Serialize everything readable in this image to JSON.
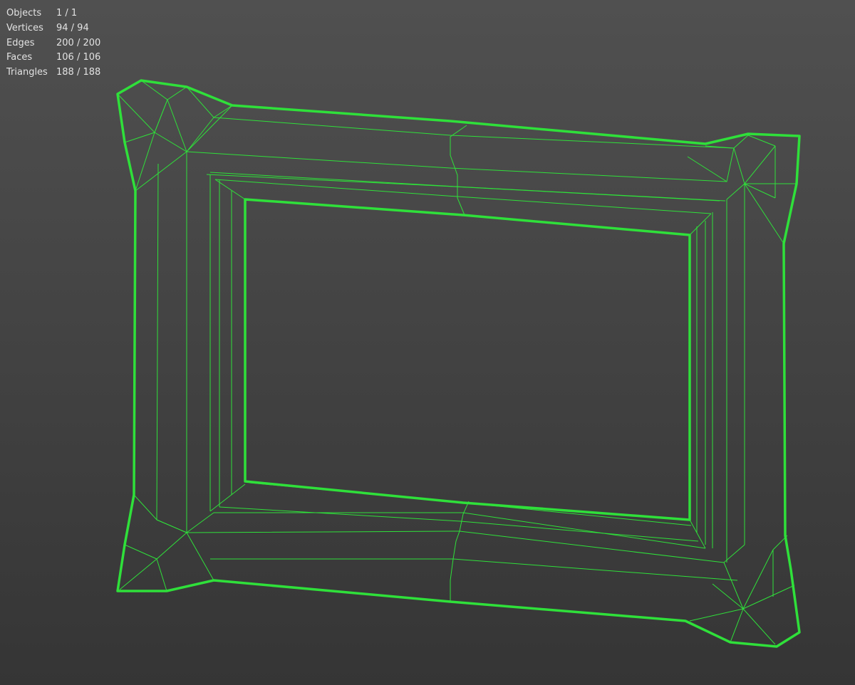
{
  "overlay": {
    "stats": [
      {
        "label": "Objects",
        "value": "1 / 1"
      },
      {
        "label": "Vertices",
        "value": "94 / 94"
      },
      {
        "label": "Edges",
        "value": "200 / 200"
      },
      {
        "label": "Faces",
        "value": "106 / 106"
      },
      {
        "label": "Triangles",
        "value": "188 / 188"
      }
    ]
  },
  "colors": {
    "wireframe": "#2fe03a",
    "background_top": "#505050",
    "background_bottom": "#353535",
    "overlay_text": "#e2e2e2"
  }
}
